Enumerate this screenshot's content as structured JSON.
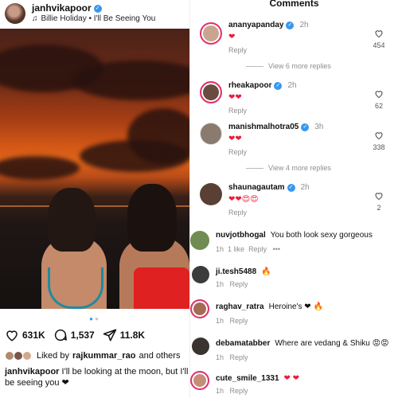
{
  "post": {
    "username": "janhvikapoor",
    "song": "Billie Holiday • I'll Be Seeing You",
    "likes": "631K",
    "comments": "1,537",
    "shares": "11.8K",
    "liked_by_prefix": "Liked by",
    "liked_by_user": "rajkummar_rao",
    "liked_by_suffix": "and others",
    "caption_user": "janhvikapoor",
    "caption_text": "I'll be looking at the moon, but I'll be seeing you ❤"
  },
  "comments": {
    "title": "Comments",
    "items": [
      {
        "user": "ananyapanday",
        "verified": true,
        "time": "2h",
        "text": "❤",
        "likes": "454",
        "reply": "Reply"
      },
      {
        "user": "rheakapoor",
        "verified": true,
        "time": "2h",
        "text": "❤❤",
        "likes": "62",
        "reply": "Reply"
      },
      {
        "user": "manishmalhotra05",
        "verified": true,
        "time": "3h",
        "text": "❤❤",
        "likes": "338",
        "reply": "Reply"
      },
      {
        "user": "shaunagautam",
        "verified": true,
        "time": "2h",
        "text": "❤❤😍😍",
        "likes": "2",
        "reply": "Reply"
      },
      {
        "user": "nuvjotbhogal",
        "verified": false,
        "time": "1h",
        "text": "You both look sexy gorgeous",
        "like_count": "1 like",
        "reply": "Reply",
        "more": "•••"
      },
      {
        "user": "ji.tesh5488",
        "verified": false,
        "time": "1h",
        "text": "🔥",
        "reply": "Reply"
      },
      {
        "user": "raghav_ratra",
        "verified": false,
        "time": "1h",
        "text": "Heroine's ❤ 🔥",
        "reply": "Reply"
      },
      {
        "user": "debamatabber",
        "verified": false,
        "time": "1h",
        "text": "Where are vedang & Shiku 😡😡",
        "reply": "Reply"
      },
      {
        "user": "cute_smile_1331",
        "verified": false,
        "time": "1h",
        "text": "❤ ❤",
        "reply": "Reply"
      }
    ],
    "view_more_1": "View 6 more replies",
    "view_more_2": "View 4 more replies"
  },
  "icons": [
    "verified-icon",
    "music-note-icon",
    "heart-icon",
    "comment-icon",
    "share-icon"
  ],
  "colors": {
    "verified": "#3897f0",
    "heart": "#ed1c3a",
    "story_ring": "#e1306c"
  }
}
